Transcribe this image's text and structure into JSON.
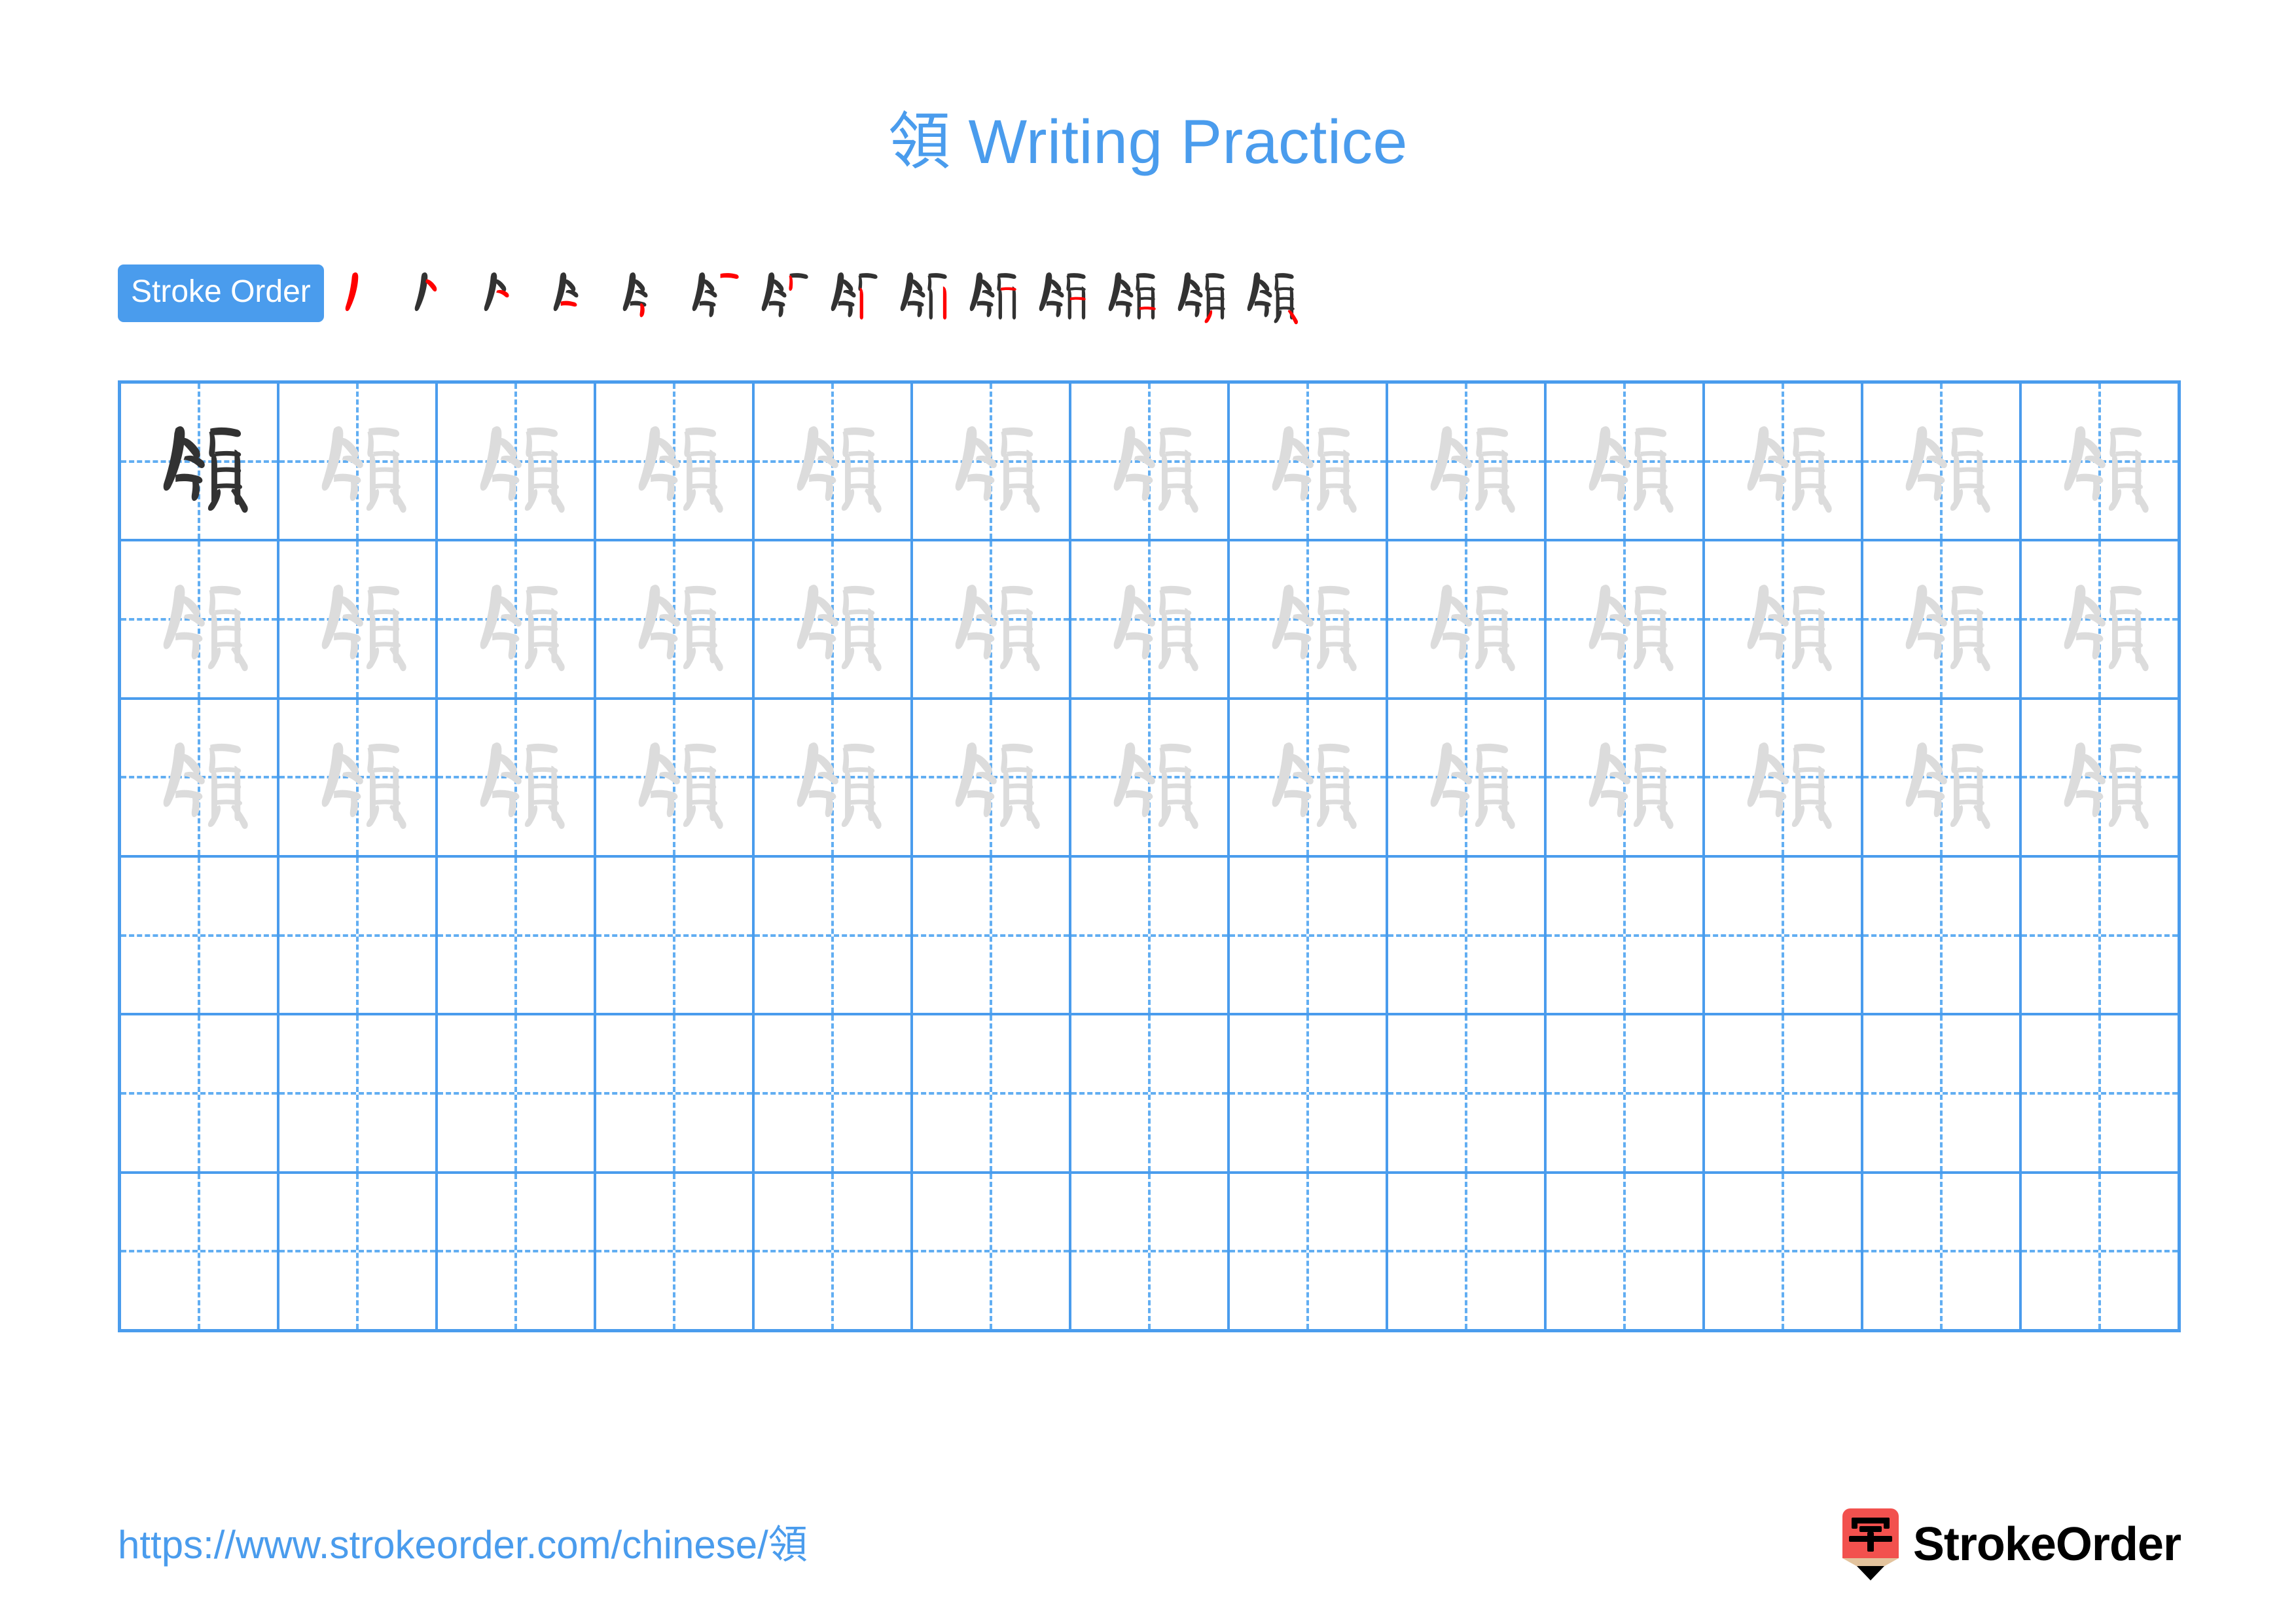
{
  "page": {
    "character": "領",
    "title": "領 Writing Practice",
    "background_color": "#ffffff",
    "accent_color": "#4a9ced",
    "highlight_stroke_color": "#ff0000",
    "ink_color": "#323232",
    "trace_color": "#dcdcdc"
  },
  "stroke_order": {
    "badge_label": "Stroke Order",
    "badge_background": "#4a9ced",
    "badge_text_color": "#ffffff",
    "total_strokes": 14,
    "steps": [
      {
        "index": 1,
        "strokes_shown": 1,
        "new_stroke": 1
      },
      {
        "index": 2,
        "strokes_shown": 2,
        "new_stroke": 2
      },
      {
        "index": 3,
        "strokes_shown": 3,
        "new_stroke": 3
      },
      {
        "index": 4,
        "strokes_shown": 4,
        "new_stroke": 4
      },
      {
        "index": 5,
        "strokes_shown": 5,
        "new_stroke": 5
      },
      {
        "index": 6,
        "strokes_shown": 6,
        "new_stroke": 6
      },
      {
        "index": 7,
        "strokes_shown": 7,
        "new_stroke": 7
      },
      {
        "index": 8,
        "strokes_shown": 8,
        "new_stroke": 8
      },
      {
        "index": 9,
        "strokes_shown": 9,
        "new_stroke": 9
      },
      {
        "index": 10,
        "strokes_shown": 10,
        "new_stroke": 10
      },
      {
        "index": 11,
        "strokes_shown": 11,
        "new_stroke": 11
      },
      {
        "index": 12,
        "strokes_shown": 12,
        "new_stroke": 12
      },
      {
        "index": 13,
        "strokes_shown": 13,
        "new_stroke": 13
      },
      {
        "index": 14,
        "strokes_shown": 14,
        "new_stroke": 14
      }
    ]
  },
  "practice_grid": {
    "columns": 13,
    "rows": 6,
    "filled_rows": 3,
    "empty_rows": 3,
    "first_cell_style": "dark",
    "trace_cell_style": "light",
    "guide_style": "dashed-cross",
    "border_color": "#4a9ced",
    "guide_color": "#62aef2",
    "row_fill": [
      [
        "dark",
        "light",
        "light",
        "light",
        "light",
        "light",
        "light",
        "light",
        "light",
        "light",
        "light",
        "light",
        "light"
      ],
      [
        "light",
        "light",
        "light",
        "light",
        "light",
        "light",
        "light",
        "light",
        "light",
        "light",
        "light",
        "light",
        "light"
      ],
      [
        "light",
        "light",
        "light",
        "light",
        "light",
        "light",
        "light",
        "light",
        "light",
        "light",
        "light",
        "light",
        "light"
      ],
      [
        "empty",
        "empty",
        "empty",
        "empty",
        "empty",
        "empty",
        "empty",
        "empty",
        "empty",
        "empty",
        "empty",
        "empty",
        "empty"
      ],
      [
        "empty",
        "empty",
        "empty",
        "empty",
        "empty",
        "empty",
        "empty",
        "empty",
        "empty",
        "empty",
        "empty",
        "empty",
        "empty"
      ],
      [
        "empty",
        "empty",
        "empty",
        "empty",
        "empty",
        "empty",
        "empty",
        "empty",
        "empty",
        "empty",
        "empty",
        "empty",
        "empty"
      ]
    ]
  },
  "footer": {
    "url": "https://www.strokeorder.com/chinese/領",
    "logo_wordmark": "StrokeOrder",
    "logo_glyph": "字",
    "logo_body_color": "#f2514e",
    "logo_wood_color": "#e3c39d",
    "logo_tip_color": "#000000"
  }
}
